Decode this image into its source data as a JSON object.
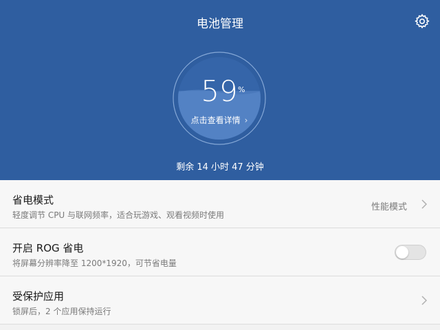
{
  "header": {
    "title": "电池管理",
    "settings_icon": "gear-icon",
    "background": "#2f5ea0"
  },
  "battery": {
    "percent": "59",
    "percent_unit": "%",
    "level": 0.59,
    "details_link": "点击查看详情",
    "remaining": "剩余 14 小时 47 分钟"
  },
  "settings": {
    "power_saving": {
      "title": "省电模式",
      "subtitle": "轻度调节 CPU 与联网频率，适合玩游戏、观看视频时使用",
      "value": "性能模式"
    },
    "rog": {
      "title": "开启 ROG 省电",
      "subtitle": "将屏幕分辨率降至 1200*1920，可节省电量",
      "enabled": false
    },
    "protected_apps": {
      "title": "受保护应用",
      "subtitle": "锁屏后，2 个应用保持运行"
    }
  }
}
